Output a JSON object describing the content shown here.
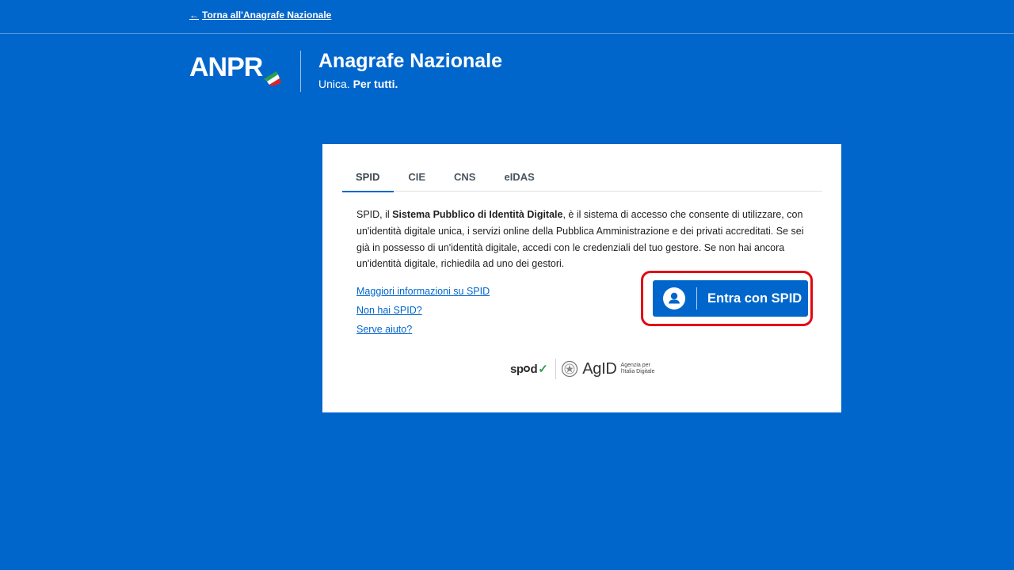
{
  "header": {
    "back_link": "Torna all'Anagrafe Nazionale",
    "logo_text": "ANPR",
    "title": "Anagrafe Nazionale",
    "tagline_part1": "Unica.",
    "tagline_part2": "Per tutti."
  },
  "tabs": [
    {
      "label": "SPID",
      "active": true
    },
    {
      "label": "CIE",
      "active": false
    },
    {
      "label": "CNS",
      "active": false
    },
    {
      "label": "eIDAS",
      "active": false
    }
  ],
  "description": {
    "part1": "SPID, il ",
    "bold": "Sistema Pubblico di Identità Digitale",
    "part2": ", è il sistema di accesso che consente di utilizzare, con un'identità digitale unica, i servizi online della Pubblica Amministrazione e dei privati accreditati. Se sei già in possesso di un'identità digitale, accedi con le credenziali del tuo gestore. Se non hai ancora un'identità digitale, richiedila ad uno dei gestori."
  },
  "links": [
    "Maggiori informazioni su SPID",
    "Non hai SPID?",
    "Serve aiuto?"
  ],
  "spid_button": {
    "label": "Entra con SPID"
  },
  "footer_logos": {
    "spid": "sp",
    "spid_rest": "d",
    "agid": "AgID",
    "agid_sub": "Agenzia per l'Italia Digitale"
  },
  "colors": {
    "background": "#0066cc",
    "card": "#ffffff",
    "highlight": "#e30613",
    "link": "#0066cc"
  },
  "icons": {
    "back": "arrow-left-icon",
    "user": "user-circle-icon",
    "flag": "italian-flag-swoosh"
  }
}
